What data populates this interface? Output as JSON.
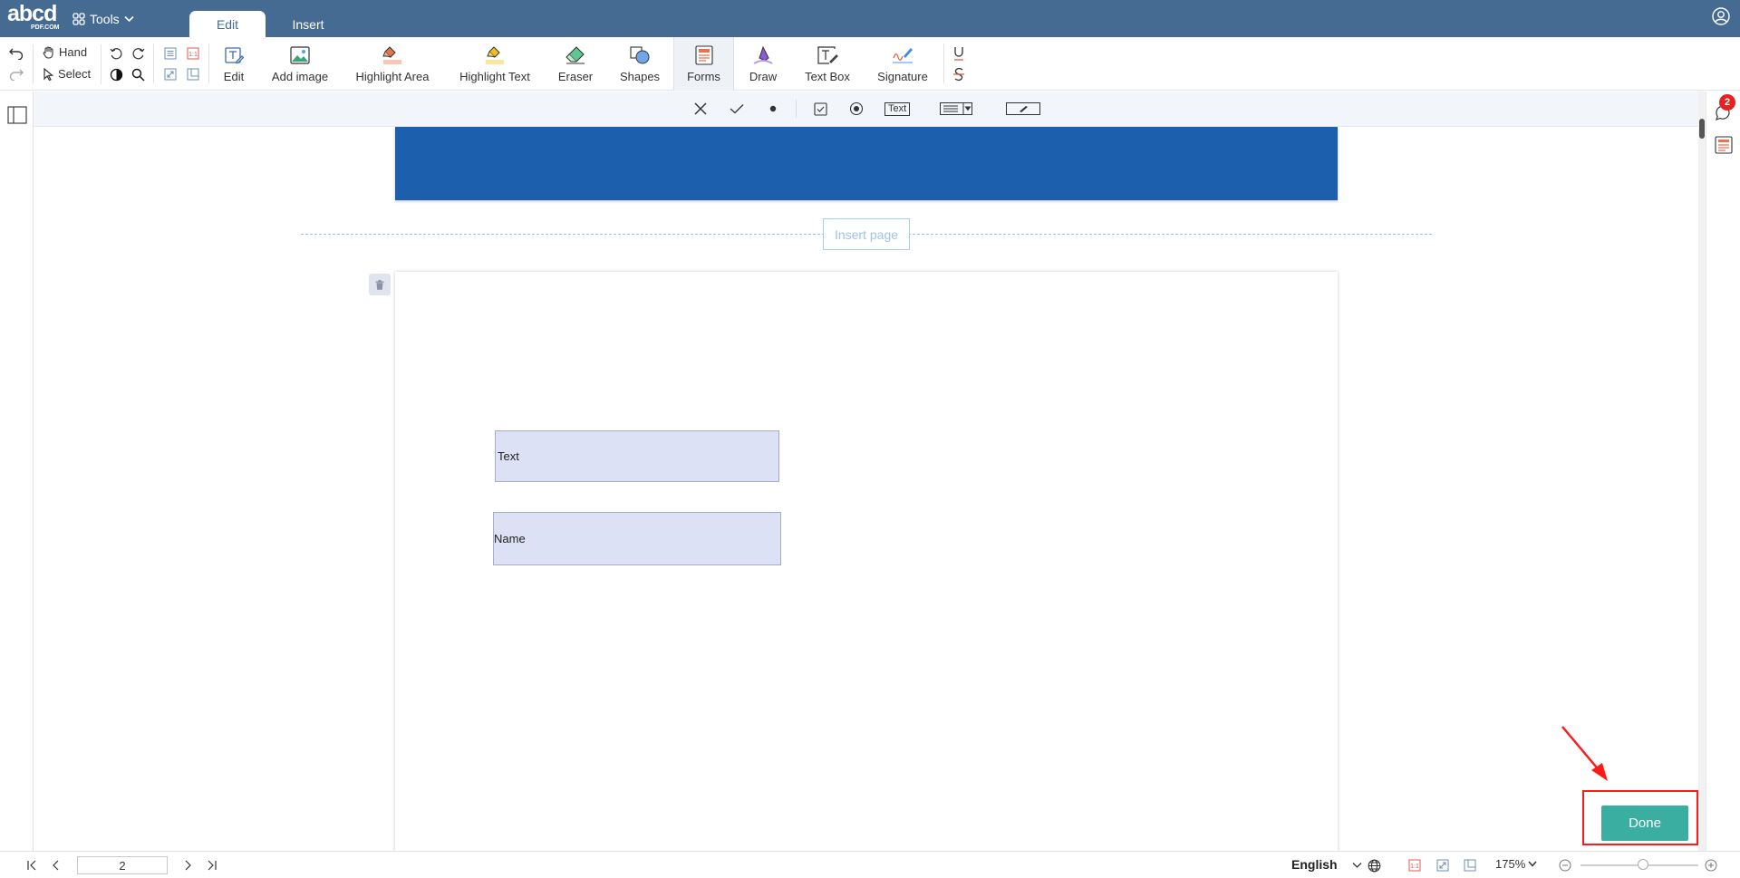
{
  "app": {
    "logo_text": "abcd",
    "logo_sub": "PDF.COM",
    "tools_label": "Tools"
  },
  "tabs": [
    {
      "label": "Edit",
      "active": true
    },
    {
      "label": "Insert",
      "active": false
    }
  ],
  "toolbar": {
    "hand_label": "Hand",
    "select_label": "Select",
    "tools": [
      {
        "label": "Edit",
        "icon": "edit-text-icon"
      },
      {
        "label": "Add image",
        "icon": "image-icon"
      },
      {
        "label": "Highlight Area",
        "icon": "highlight-area-icon"
      },
      {
        "label": "Highlight Text",
        "icon": "highlight-text-icon"
      },
      {
        "label": "Eraser",
        "icon": "eraser-icon"
      },
      {
        "label": "Shapes",
        "icon": "shapes-icon"
      },
      {
        "label": "Forms",
        "icon": "forms-icon",
        "active": true
      },
      {
        "label": "Draw",
        "icon": "draw-icon"
      },
      {
        "label": "Text Box",
        "icon": "text-box-icon"
      },
      {
        "label": "Signature",
        "icon": "signature-icon"
      }
    ]
  },
  "forms_bar": {
    "text_field_label": "Text"
  },
  "document": {
    "insert_page_label": "Insert page",
    "fields": [
      {
        "name": "text-form-field",
        "value": "Text"
      },
      {
        "name": "name-form-field",
        "value": "Name"
      }
    ]
  },
  "comments_badge": "2",
  "done_label": "Done",
  "statusbar": {
    "current_page": "2",
    "language": "English",
    "zoom": "175%"
  },
  "colors": {
    "topbar": "#456b93",
    "page_header": "#1c5fad",
    "form_field_fill": "#dde1f6",
    "done_button": "#3aaea1",
    "highlight_annotation": "#ff1a1a",
    "badge": "#e52222"
  }
}
